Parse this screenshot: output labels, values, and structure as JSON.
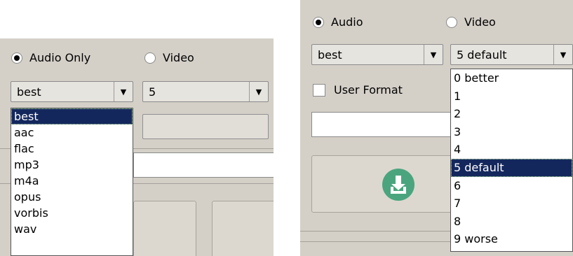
{
  "left": {
    "radio_audio": "Audio Only",
    "radio_video": "Video",
    "format_combo": "best",
    "quality_combo": "5",
    "format_options": [
      "best",
      "aac",
      "flac",
      "mp3",
      "m4a",
      "opus",
      "vorbis",
      "wav"
    ],
    "selected_format": "best"
  },
  "right": {
    "radio_audio": "Audio",
    "radio_video": "Video",
    "format_combo": "best",
    "quality_combo": "5 default",
    "user_format_label": "User Format",
    "quality_options": [
      "0 better",
      "1",
      "2",
      "3",
      "4",
      "5 default",
      "6",
      "7",
      "8",
      "9 worse"
    ],
    "selected_quality": "5 default"
  },
  "colors": {
    "selection": "#14275d",
    "panel": "#d4d0c8",
    "download_icon": "#4aa57e"
  },
  "icons": {
    "combo_arrow": "triangle-down",
    "download": "download-icon"
  }
}
